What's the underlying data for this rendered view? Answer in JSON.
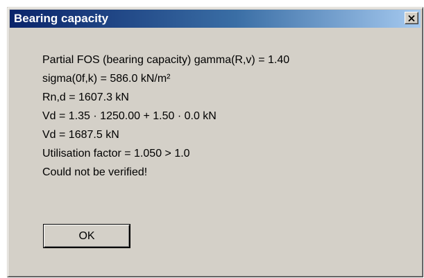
{
  "window": {
    "title": "Bearing capacity",
    "close_icon": "close-icon"
  },
  "message": {
    "lines": [
      "Partial FOS (bearing capacity) gamma(R,v) = 1.40",
      "sigma(0f,k) = 586.0 kN/m²",
      "Rn,d = 1607.3 kN",
      "Vd = 1.35 · 1250.00 + 1.50 · 0.0 kN",
      "Vd = 1687.5 kN",
      "Utilisation factor = 1.050 > 1.0",
      "Could not be verified!"
    ]
  },
  "buttons": {
    "ok_label": "OK"
  },
  "colors": {
    "title_bar_start": "#0a246a",
    "title_bar_end": "#a6caf0",
    "dialog_face": "#d4d0c8"
  }
}
